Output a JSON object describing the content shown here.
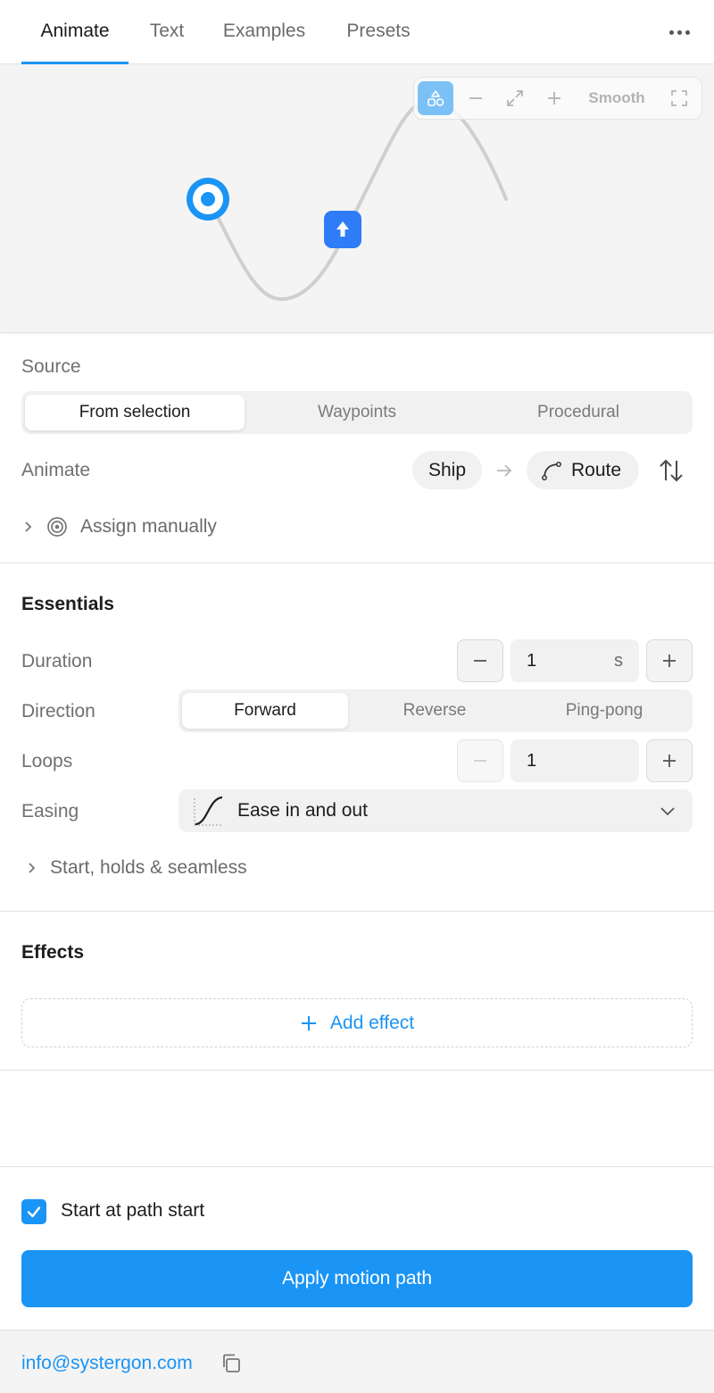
{
  "tabs": [
    "Animate",
    "Text",
    "Examples",
    "Presets"
  ],
  "active_tab": "Animate",
  "canvas_toolbar": {
    "smooth_label": "Smooth"
  },
  "source": {
    "label": "Source",
    "options": [
      "From selection",
      "Waypoints",
      "Procedural"
    ],
    "selected": "From selection"
  },
  "animate": {
    "label": "Animate",
    "object": "Ship",
    "path": "Route",
    "assign_label": "Assign manually"
  },
  "essentials": {
    "heading": "Essentials",
    "duration_label": "Duration",
    "duration_value": "1",
    "duration_unit": "s",
    "direction_label": "Direction",
    "direction_options": [
      "Forward",
      "Reverse",
      "Ping-pong"
    ],
    "direction_selected": "Forward",
    "loops_label": "Loops",
    "loops_value": "1",
    "easing_label": "Easing",
    "easing_value": "Ease in and out",
    "advanced_label": "Start, holds & seamless"
  },
  "effects": {
    "heading": "Effects",
    "add_label": "Add effect"
  },
  "start_at_path_start": {
    "label": "Start at path start",
    "checked": true
  },
  "apply_label": "Apply motion path",
  "footer": {
    "email": "info@systergon.com"
  },
  "colors": {
    "accent": "#1a94f5",
    "ship": "#2f7df6",
    "toolbar_active": "#7cc1f6"
  }
}
